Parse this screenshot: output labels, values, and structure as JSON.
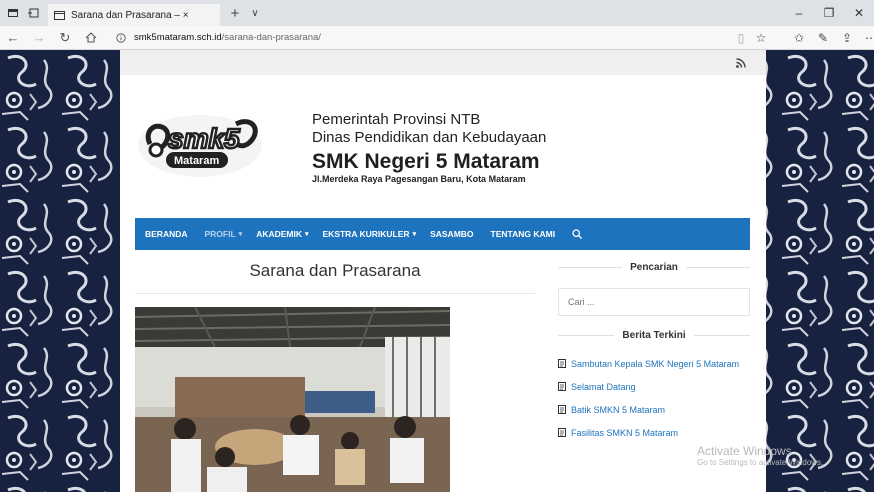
{
  "browser": {
    "tab_title": "Sarana dan Prasarana – ×",
    "url_domain": "smk5mataram.sch.id",
    "url_path": "/sarana-dan-prasarana/"
  },
  "header": {
    "line1": "Pemerintah Provinsi NTB",
    "line2": "Dinas Pendidikan dan Kebudayaan",
    "school": "SMK Negeri 5 Mataram",
    "address": "Jl.Merdeka Raya Pagesangan Baru, Kota Mataram",
    "logo_text": "smk5",
    "logo_sub": "Mataram"
  },
  "menu": [
    {
      "label": "BERANDA",
      "caret": ""
    },
    {
      "label": "PROFIL",
      "caret": "▾"
    },
    {
      "label": "AKADEMIK",
      "caret": "▾"
    },
    {
      "label": "EKSTRA KURIKULER",
      "caret": "▾"
    },
    {
      "label": "SASAMBO",
      "caret": ""
    },
    {
      "label": "TENTANG KAMI",
      "caret": ""
    }
  ],
  "page_title": "Sarana dan Prasarana",
  "sidebar": {
    "search_title": "Pencarian",
    "search_placeholder": "Cari ...",
    "news_title": "Berita Terkini",
    "posts": [
      "Sambutan Kepala SMK Negeri 5 Mataram",
      "Selamat Datang",
      "Batik SMKN 5 Mataram",
      "Fasilitas SMKN 5 Mataram"
    ]
  },
  "watermark": {
    "line1": "Activate Windows",
    "line2": "Go to Settings to activate Windows."
  },
  "colors": {
    "menu_bg": "#1e73be",
    "menu_active": "#b5d3f0",
    "link": "#1e73be",
    "batik_bg": "#16223f"
  }
}
